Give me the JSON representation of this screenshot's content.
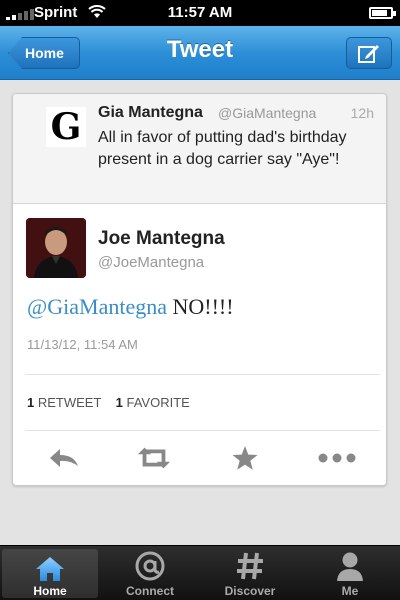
{
  "status_bar": {
    "carrier": "Sprint",
    "time": "11:57 AM",
    "battery_level": 0.85
  },
  "nav": {
    "back_label": "Home",
    "title": "Tweet"
  },
  "parent_tweet": {
    "avatar_letter": "G",
    "name": "Gia Mantegna",
    "handle": "@GiaMantegna",
    "time": "12h",
    "text": "All in favor of putting dad's birthday present in a dog carrier say \"Aye\"!"
  },
  "tweet": {
    "name": "Joe Mantegna",
    "handle": "@JoeMantegna",
    "mention": "@GiaMantegna",
    "text": " NO!!!!",
    "date": "11/13/12, 11:54 AM",
    "retweet_count": "1",
    "retweet_label": "RETWEET",
    "favorite_count": "1",
    "favorite_label": "FAVORITE"
  },
  "actions": {
    "icons": [
      "reply-icon",
      "retweet-icon",
      "favorite-icon",
      "more-icon"
    ]
  },
  "tabs": [
    {
      "label": "Home",
      "icon": "home-icon",
      "active": true
    },
    {
      "label": "Connect",
      "icon": "at-icon",
      "active": false
    },
    {
      "label": "Discover",
      "icon": "hashtag-icon",
      "active": false
    },
    {
      "label": "Me",
      "icon": "person-icon",
      "active": false
    }
  ],
  "colors": {
    "nav_blue": "#2d8fd7",
    "mention_blue": "#3a8dc7",
    "icon_gray": "#888888"
  }
}
